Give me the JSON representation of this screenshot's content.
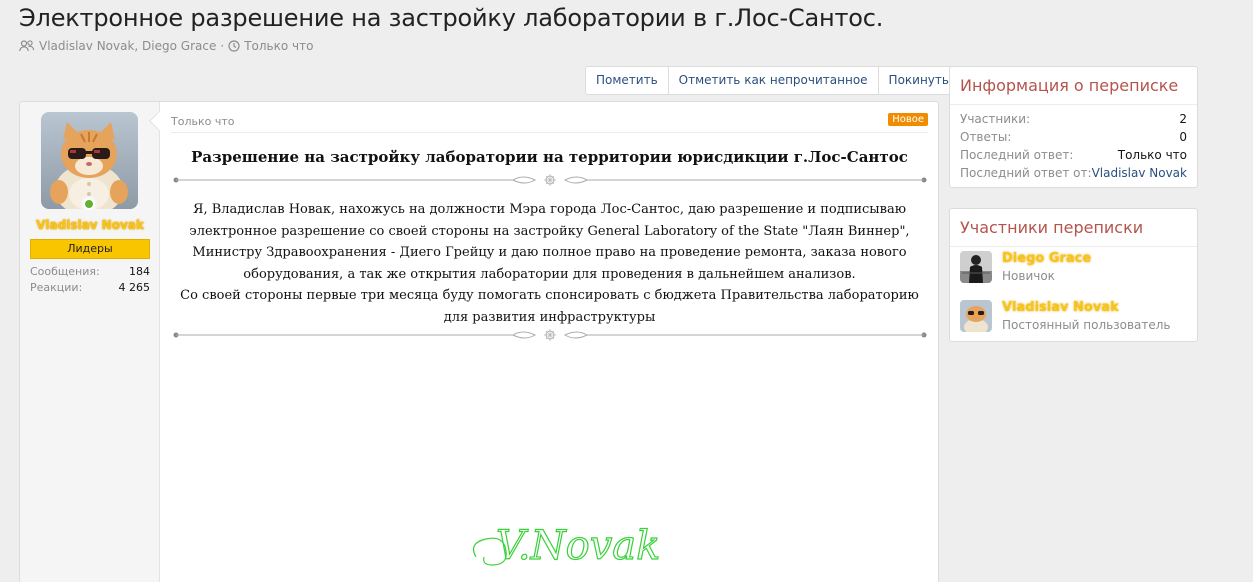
{
  "thread": {
    "title": "Электронное разрешение на застройку лаборатории в г.Лос-Сантос.",
    "participants": "Vladislav Novak, Diego Grace",
    "separator": "·",
    "time": "Только что"
  },
  "actions": {
    "mark": "Пометить",
    "mark_unread": "Отметить как непрочитанное",
    "leave": "Покинуть"
  },
  "post": {
    "author": {
      "name": "Vladislav Novak",
      "title": "Лидеры",
      "messages_label": "Сообщения:",
      "messages_value": "184",
      "reactions_label": "Реакции:",
      "reactions_value": "4 265"
    },
    "time": "Только что",
    "badge": "Новое",
    "doc_title": "Разрешение на застройку лаборатории на территории юрисдикции г.Лос-Сантос",
    "paragraphs": [
      "Я, Владислав Новак, нахожусь на должности Мэра города Лос-Сантос, даю разрешение и подписываю",
      "электронное разрешение со своей стороны на застройку General Laboratory of the State \"Лаян Виннер\",",
      "Министру Здравоохранения - Диего Грейцу и даю полное право на проведение ремонта, заказа нового",
      "оборудования, а так же открытия лаборатории для проведения в дальнейшем анализов.",
      "Со своей стороны первые три месяца буду помогать спонсировать с бюджета Правительства лабораторию",
      "для развития инфраструктуры"
    ],
    "signature": "V.Novak"
  },
  "info": {
    "title": "Информация о переписке",
    "rows": [
      {
        "label": "Участники:",
        "value": "2"
      },
      {
        "label": "Ответы:",
        "value": "0"
      },
      {
        "label": "Последний ответ:",
        "value": "Только что"
      },
      {
        "label": "Последний ответ от:",
        "value": "Vladislav Novak"
      }
    ]
  },
  "members": {
    "title": "Участники переписки",
    "items": [
      {
        "name": "Diego Grace",
        "role": "Новичок"
      },
      {
        "name": "Vladislav Novak",
        "role": "Постоянный пользователь"
      }
    ]
  },
  "colors": {
    "accent_link": "#2a4f7f",
    "block_title": "#b5544c",
    "badge_new": "#f08c00",
    "user_title_bg": "#f9c400",
    "online": "#63b132",
    "signature": "#38d238"
  },
  "icons": {
    "participants": "users-icon",
    "time": "clock-icon",
    "online": "online-status-icon"
  }
}
